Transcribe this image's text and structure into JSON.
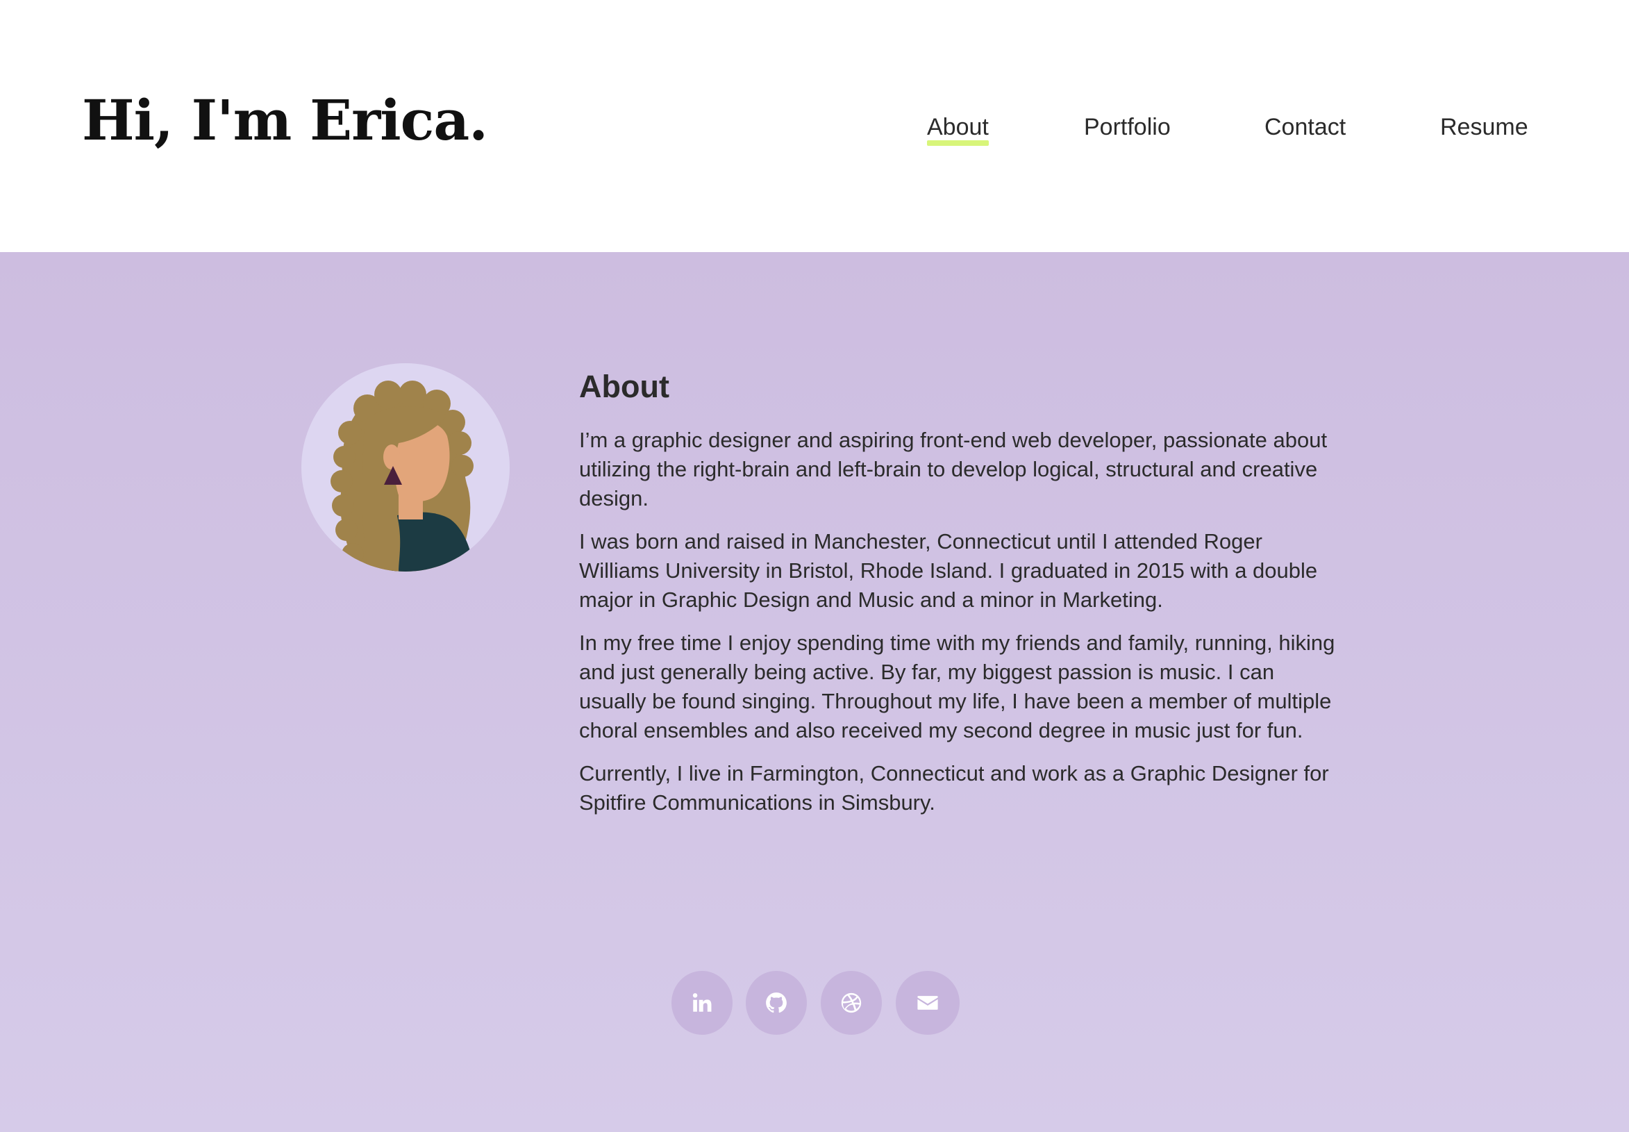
{
  "header": {
    "title": "Hi, I'm Erica."
  },
  "nav": {
    "items": [
      {
        "label": "About",
        "active": true
      },
      {
        "label": "Portfolio",
        "active": false
      },
      {
        "label": "Contact",
        "active": false
      },
      {
        "label": "Resume",
        "active": false
      }
    ]
  },
  "about": {
    "heading": "About",
    "paragraphs": [
      "I’m a graphic designer and aspiring front-end web developer, passionate about utilizing the right-brain and left-brain to develop logical, structural and creative design.",
      "I was born and raised in Manchester, Connecticut until I attended Roger Williams University in Bristol, Rhode Island. I graduated in 2015 with a double major in Graphic Design and Music and a minor in Marketing.",
      "In my free time I enjoy spending time with my friends and family, running, hiking and just generally being active. By far, my biggest passion is music. I can usually be found singing. Throughout my life, I have been a member of multiple choral ensembles and also received my second degree in music just for fun.",
      "Currently, I live in Farmington, Connecticut and work as a Graphic Designer for Spitfire Communications in Simsbury."
    ]
  },
  "social": {
    "icons": [
      "linkedin-icon",
      "github-icon",
      "dribbble-icon",
      "email-icon"
    ]
  },
  "colors": {
    "nav_active_underline": "#d8f57a",
    "content_background_top": "#cdbde0",
    "content_background_bottom": "#d6cbe9",
    "social_button": "#c7b5dd",
    "avatar_background": "#ddd6f1",
    "text": "#2b2b2b"
  }
}
